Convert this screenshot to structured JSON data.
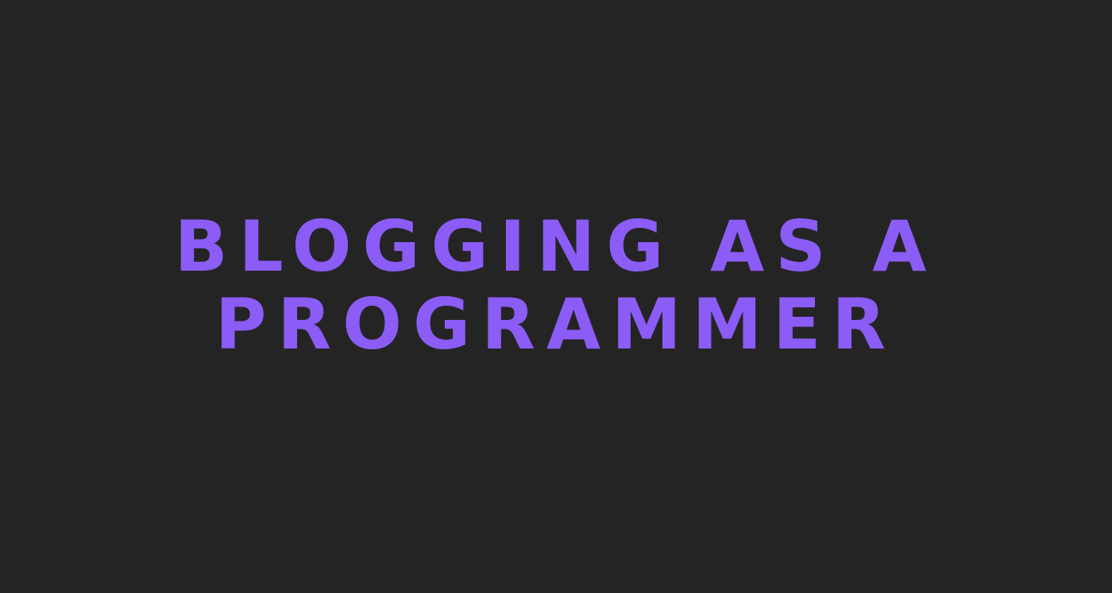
{
  "headline": {
    "line1": "BLOGGING AS A",
    "line2": "PROGRAMMER"
  },
  "colors": {
    "background": "#252424",
    "text": "#8B5CF6"
  }
}
